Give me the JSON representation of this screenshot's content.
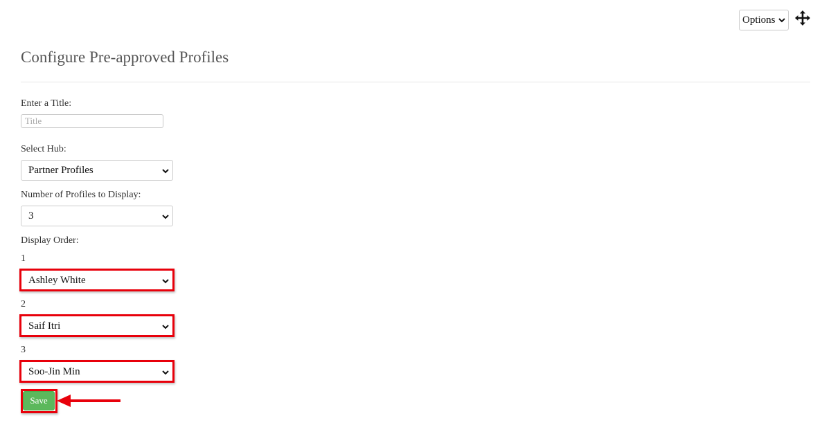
{
  "header": {
    "options_label": "Options"
  },
  "page": {
    "title": "Configure Pre-approved Profiles"
  },
  "form": {
    "title_label": "Enter a Title:",
    "title_placeholder": "Title",
    "title_value": "",
    "hub_label": "Select Hub:",
    "hub_value": "Partner Profiles",
    "count_label": "Number of Profiles to Display:",
    "count_value": "3",
    "order_label": "Display Order:",
    "order_items": [
      {
        "index": "1",
        "value": "Ashley White"
      },
      {
        "index": "2",
        "value": "Saif Itri"
      },
      {
        "index": "3",
        "value": "Soo-Jin Min"
      }
    ],
    "save_label": "Save"
  },
  "icons": {
    "move": "move-arrows-icon",
    "dropdown": "chevron-down-icon"
  },
  "colors": {
    "highlight": "#e8000b",
    "save_button": "#5cb85c",
    "title_text": "#555555"
  }
}
